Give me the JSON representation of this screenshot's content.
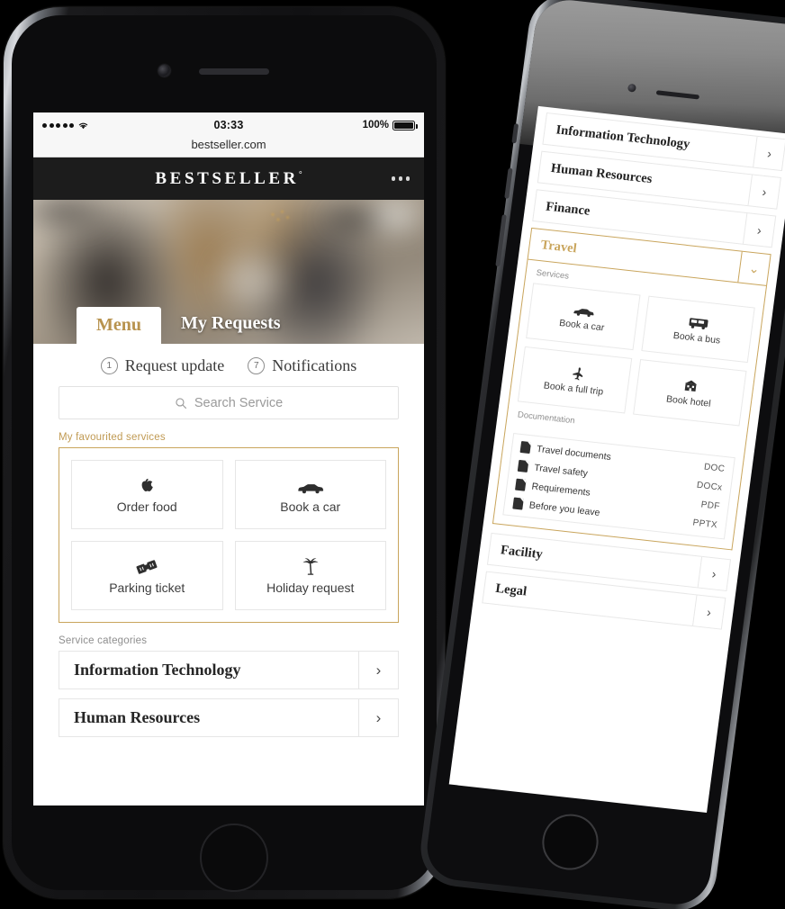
{
  "theme": {
    "accent_gold": "#c9a55c",
    "text_dark": "#232323",
    "frame_black": "#0c0c0d",
    "frame_gray": "#2a2b2e"
  },
  "left_phone": {
    "statusbar": {
      "time": "03:33",
      "battery_percent": "100%",
      "signal_icon": "signal-dots-icon",
      "wifi_icon": "wifi-icon",
      "battery_icon": "battery-icon"
    },
    "url": "bestseller.com",
    "header": {
      "brand": "BESTSELLER",
      "brand_mark": "°",
      "menu_icon": "overflow-menu-icon"
    },
    "tabs": [
      {
        "label": "Menu",
        "active": true
      },
      {
        "label": "My Requests",
        "active": false
      }
    ],
    "status_items": [
      {
        "count": "1",
        "label": "Request update"
      },
      {
        "count": "7",
        "label": "Notifications"
      }
    ],
    "search": {
      "placeholder": "Search Service",
      "icon": "search-icon"
    },
    "favourites": {
      "label": "My favourited services",
      "tiles": [
        {
          "label": "Order food",
          "icon": "apple-icon"
        },
        {
          "label": "Book a car",
          "icon": "car-icon"
        },
        {
          "label": "Parking ticket",
          "icon": "ticket-icon"
        },
        {
          "label": "Holiday request",
          "icon": "palm-tree-icon"
        }
      ]
    },
    "categories": {
      "label": "Service categories",
      "items": [
        {
          "label": "Information Technology",
          "chevron": "chevron-right-icon"
        },
        {
          "label": "Human Resources",
          "chevron": "chevron-right-icon"
        }
      ]
    }
  },
  "right_phone": {
    "categories_top": [
      {
        "label": "Information Technology",
        "chevron": "chevron-right-icon",
        "active": false
      },
      {
        "label": "Human Resources",
        "chevron": "chevron-right-icon",
        "active": false
      },
      {
        "label": "Finance",
        "chevron": "chevron-right-icon",
        "active": false
      },
      {
        "label": "Travel",
        "chevron": "chevron-down-icon",
        "active": true
      }
    ],
    "services": {
      "label": "Services",
      "tiles": [
        {
          "label": "Book a car",
          "icon": "car-icon"
        },
        {
          "label": "Book a bus",
          "icon": "bus-icon"
        },
        {
          "label": "Book a full trip",
          "icon": "airplane-icon"
        },
        {
          "label": "Book hotel",
          "icon": "hotel-icon"
        }
      ]
    },
    "documentation": {
      "label": "Documentation",
      "items": [
        {
          "name": "Travel documents",
          "ext": "DOC",
          "icon": "document-icon"
        },
        {
          "name": "Travel safety",
          "ext": "DOCx",
          "icon": "document-icon"
        },
        {
          "name": "Requirements",
          "ext": "PDF",
          "icon": "document-icon"
        },
        {
          "name": "Before you leave",
          "ext": "PPTX",
          "icon": "document-icon"
        }
      ]
    },
    "categories_bottom": [
      {
        "label": "Facility",
        "chevron": "chevron-right-icon"
      },
      {
        "label": "Legal",
        "chevron": "chevron-right-icon"
      }
    ]
  }
}
